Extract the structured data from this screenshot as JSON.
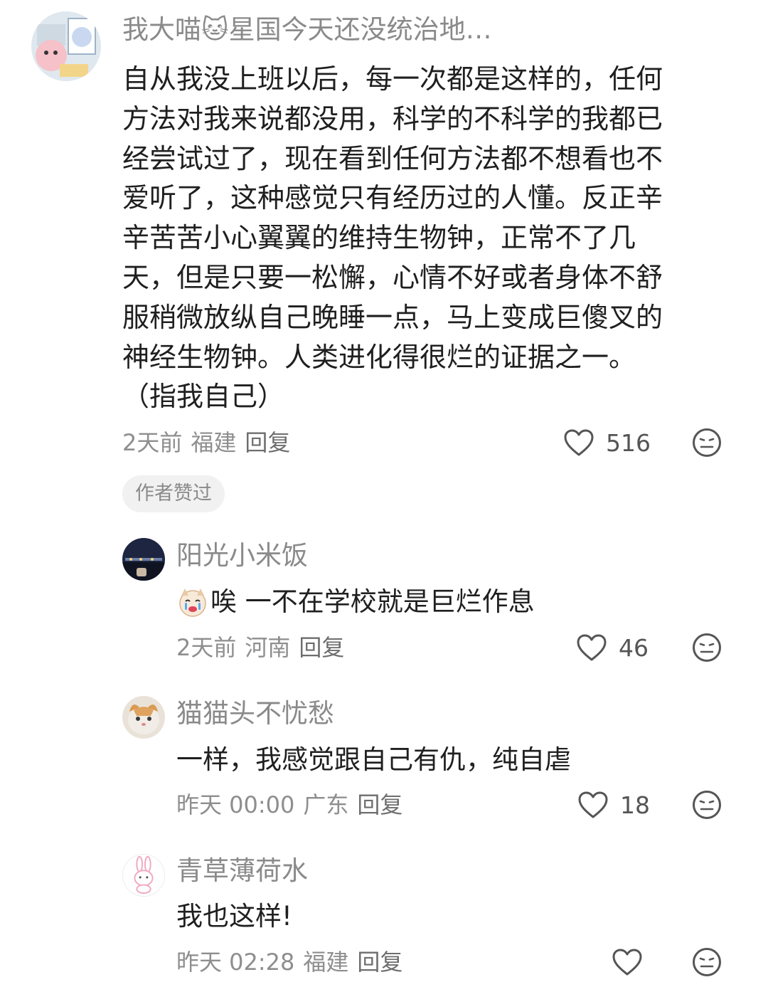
{
  "main_comment": {
    "username": "我大喵🐱星国今天还没统治地…",
    "lines": [
      "自从我没上班以后，每一次都是这样的，任何",
      "方法对我来说都没用，科学的不科学的我都已",
      "经尝试过了，现在看到任何方法都不想看也不",
      "爱听了，这种感觉只有经历过的人懂。反正辛",
      "辛苦苦小心翼翼的维持生物钟，正常不了几",
      "天，但是只要一松懈，心情不好或者身体不舒",
      "服稍微放纵自己晚睡一点，马上变成巨傻叉的",
      "神经生物钟。人类进化得很烂的证据之一。",
      "（指我自己）"
    ],
    "time": "2天前",
    "location": "福建",
    "reply_label": "回复",
    "likes": "516",
    "badge": "作者赞过"
  },
  "replies": [
    {
      "username": "阳光小米饭",
      "text": "唉 一不在学校就是巨烂作息",
      "time": "2天前",
      "location": "河南",
      "reply_label": "回复",
      "likes": "46"
    },
    {
      "username": "猫猫头不忧愁",
      "text": "一样，我感觉跟自己有仇，纯自虐",
      "time": "昨天 00:00",
      "location": "广东",
      "reply_label": "回复",
      "likes": "18"
    },
    {
      "username": "青草薄荷水",
      "text": "我也这样!",
      "time": "昨天 02:28",
      "location": "福建",
      "reply_label": "回复",
      "likes": ""
    }
  ],
  "icons": {
    "like": "heart-outline-icon",
    "dislike": "meh-face-icon"
  },
  "colors": {
    "text": "#1f1f1f",
    "meta": "#8e8e8e",
    "badge_bg": "#f1f1f1"
  }
}
